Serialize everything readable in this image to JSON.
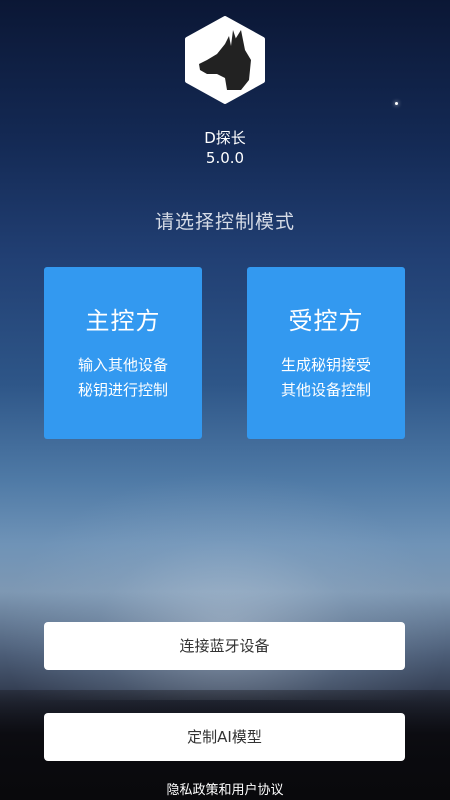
{
  "app": {
    "name": "D探长",
    "version": "5.0.0",
    "logo_icon": "dog-head-hexagon-icon"
  },
  "prompt": "请选择控制模式",
  "modes": [
    {
      "title": "主控方",
      "desc": "输入其他设备\n秘钥进行控制"
    },
    {
      "title": "受控方",
      "desc": "生成秘钥接受\n其他设备控制"
    }
  ],
  "buttons": {
    "bluetooth": "连接蓝牙设备",
    "ai_model": "定制AI模型"
  },
  "footer": {
    "privacy_link": "隐私政策和用户协议"
  },
  "colors": {
    "card_blue": "#3399f0",
    "button_bg": "#ffffff",
    "button_text": "#333333"
  }
}
